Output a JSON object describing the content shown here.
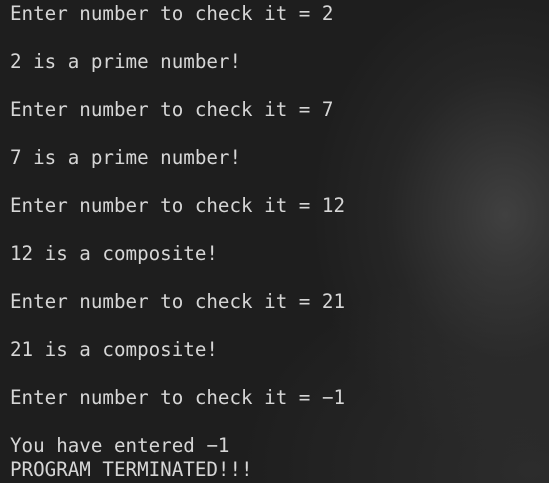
{
  "terminal": {
    "lines": [
      "Enter number to check it = 2",
      "2 is a prime number!",
      "Enter number to check it = 7",
      "7 is a prime number!",
      "Enter number to check it = 12",
      "12 is a composite!",
      "Enter number to check it = 21",
      "21 is a composite!",
      "Enter number to check it = −1",
      "You have entered −1",
      "PROGRAM TERMINATED!!!"
    ]
  }
}
